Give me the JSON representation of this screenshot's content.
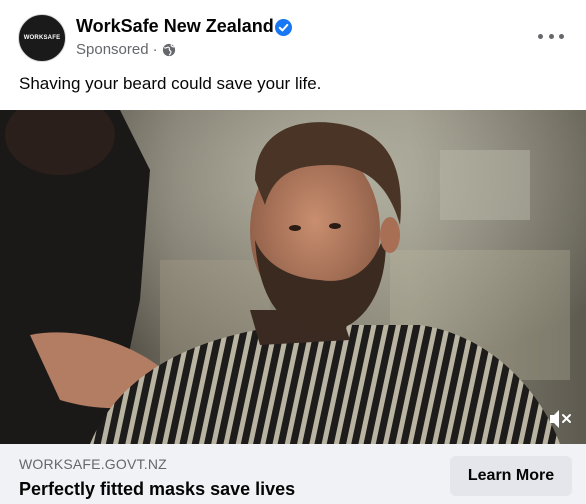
{
  "post": {
    "avatar_text": "WORKSAFE",
    "page_name": "WorkSafe New Zealand",
    "sponsored_label": "Sponsored",
    "separator": "·",
    "caption": "Shaving your beard could save your life."
  },
  "link": {
    "domain": "WORKSAFE.GOVT.NZ",
    "headline": "Perfectly fitted masks save lives",
    "cta_label": "Learn More"
  },
  "icons": {
    "verified": "verified-badge-icon",
    "privacy": "globe-icon",
    "options": "more-options-icon",
    "mute": "muted-speaker-icon"
  },
  "colors": {
    "verified_blue": "#1877f2",
    "secondary_text": "#65676b",
    "footer_bg": "#f0f2f5",
    "button_bg": "#e4e6eb"
  }
}
